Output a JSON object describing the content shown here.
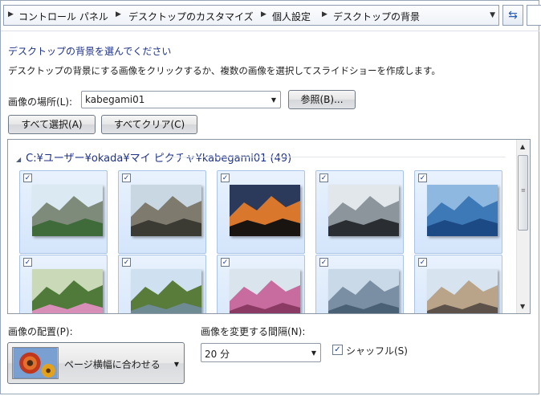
{
  "breadcrumb": {
    "items": [
      "コントロール パネル",
      "デスクトップのカスタマイズ",
      "個人設定",
      "デスクトップの背景"
    ]
  },
  "page": {
    "heading": "デスクトップの背景を選んでください",
    "description": "デスクトップの背景にする画像をクリックするか、複数の画像を選択してスライドショーを作成します。"
  },
  "location": {
    "label": "画像の場所(L):",
    "value": "kabegami01",
    "browse_label": "参照(B)..."
  },
  "selection": {
    "select_all_label": "すべて選択(A)",
    "clear_all_label": "すべてクリア(C)"
  },
  "gallery": {
    "group_title": "C:¥ユーザー¥okada¥マイ ピクチャ¥kabegami01 (49)",
    "thumbnails": [
      {
        "name": "mountain-range",
        "checked": true,
        "colors": [
          "#dbe9f3",
          "#7e8b7a",
          "#3f6a3a"
        ]
      },
      {
        "name": "rock-peak",
        "checked": true,
        "colors": [
          "#c8d7e2",
          "#7e7a6e",
          "#3b3a33"
        ]
      },
      {
        "name": "sunset",
        "checked": true,
        "colors": [
          "#2b3a5a",
          "#d9772c",
          "#1a1410"
        ]
      },
      {
        "name": "snow-rocks",
        "checked": true,
        "colors": [
          "#e2e7ec",
          "#8c949c",
          "#2a2e33"
        ]
      },
      {
        "name": "harbor-ship",
        "checked": true,
        "colors": [
          "#8fb8e0",
          "#3d78b7",
          "#1c4a85"
        ]
      },
      {
        "name": "flower-field",
        "checked": true,
        "colors": [
          "#cad9b8",
          "#4f7a3a",
          "#d78fb7"
        ]
      },
      {
        "name": "park-view",
        "checked": true,
        "colors": [
          "#cfe1f0",
          "#5a7c3a",
          "#6e8a92"
        ]
      },
      {
        "name": "pink-flowers",
        "checked": true,
        "colors": [
          "#d9e4ec",
          "#c86b9e",
          "#8a3a63"
        ]
      },
      {
        "name": "port-city",
        "checked": true,
        "colors": [
          "#c9d9e8",
          "#7a8fa3",
          "#4a6175"
        ]
      },
      {
        "name": "old-building",
        "checked": true,
        "colors": [
          "#d7e3ef",
          "#b9a48a",
          "#5c5249"
        ]
      }
    ]
  },
  "position": {
    "label": "画像の配置(P):",
    "value": "ページ横幅に合わせる"
  },
  "interval": {
    "label": "画像を変更する間隔(N):",
    "value": "20 分"
  },
  "shuffle": {
    "label": "シャッフル(S)",
    "checked": true
  },
  "colors": {
    "heading": "#1e3287",
    "tile_border": "#a9c4e6",
    "tile_bg": "#dbe9fb"
  }
}
